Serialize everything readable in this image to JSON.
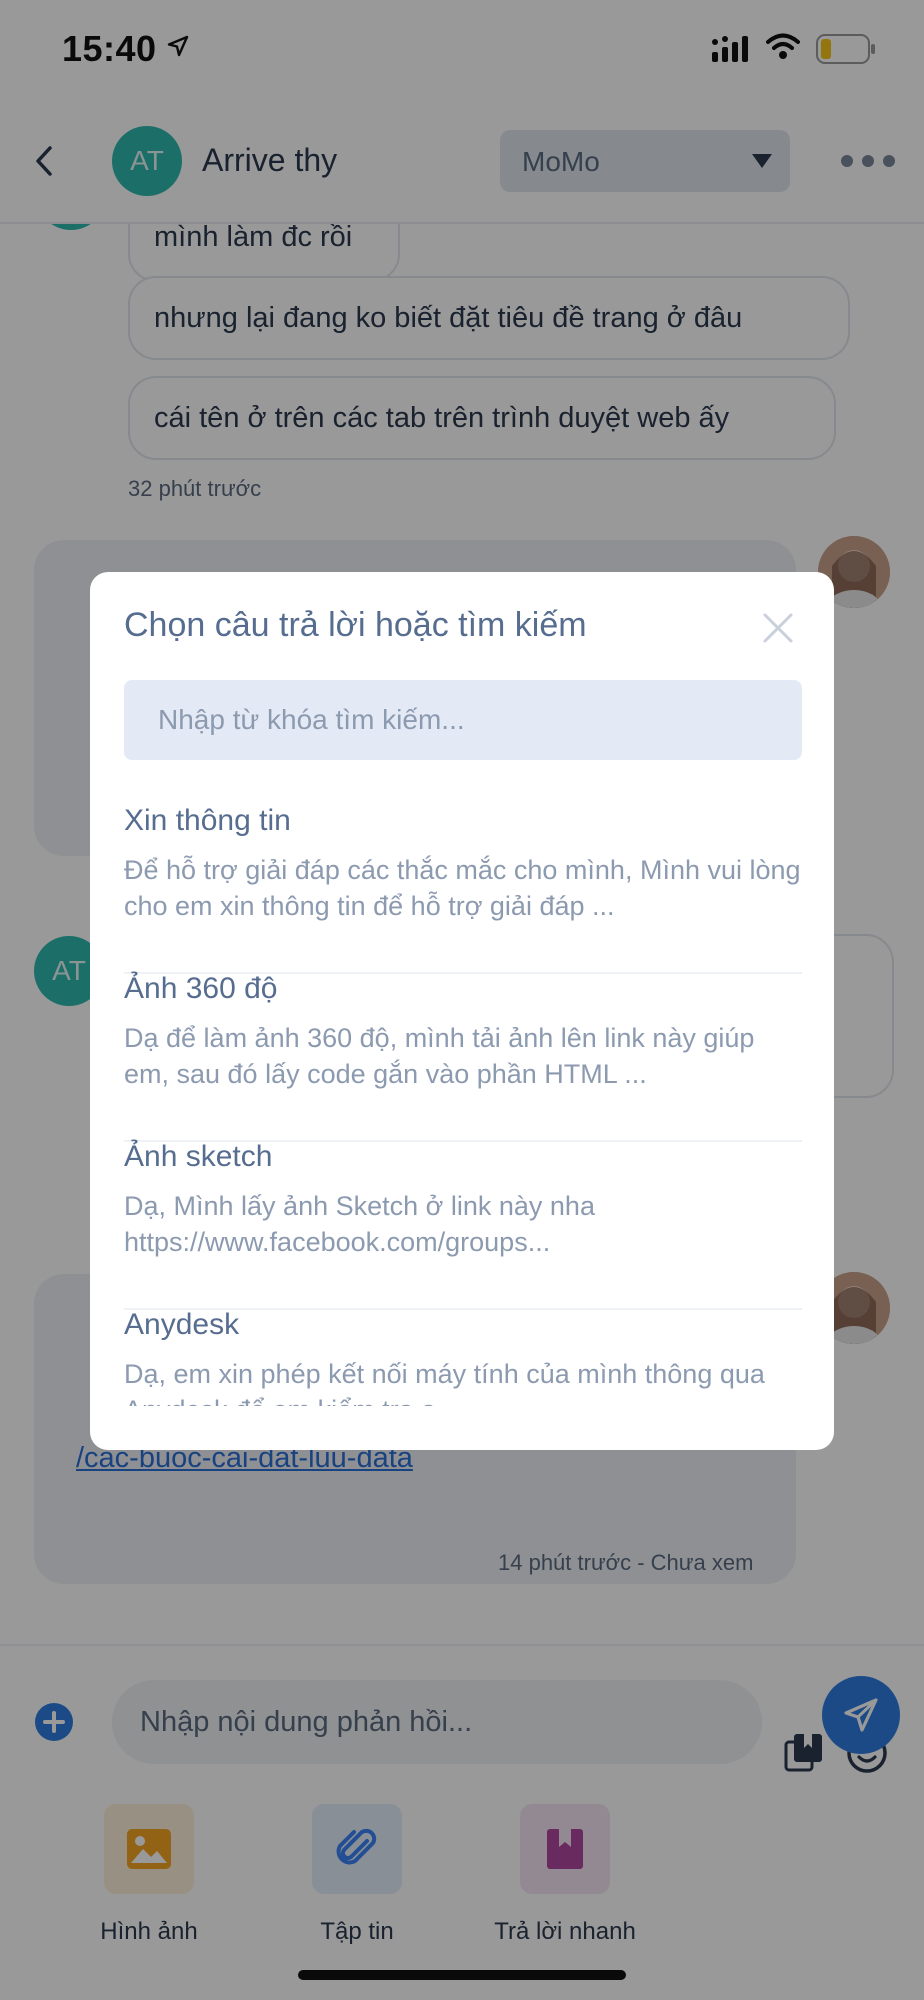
{
  "status_bar": {
    "time": "15:40",
    "icons": [
      "location-arrow-icon",
      "signal-icon",
      "wifi-icon",
      "battery-icon"
    ]
  },
  "header": {
    "avatar_initials": "AT",
    "contact_name": "Arrive thy",
    "channel_label": "MoMo",
    "icons": [
      "back-icon",
      "chevron-down-icon",
      "more-icon"
    ]
  },
  "chat": {
    "messages_in": [
      "mình làm đc rồi",
      "nhưng lại đang ko biết đặt tiêu đề trang ở đâu",
      "cái tên ở trên các tab trên trình duyệt web ấy"
    ],
    "time_1": "32 phút trước",
    "link_text": "/cac-buoc-cai-dat-luu-data",
    "time_2": "14 phút trước - Chưa xem",
    "mid_avatar_initials": "AT"
  },
  "composer": {
    "placeholder": "Nhập nội dung phản hồi...",
    "icons": [
      "plus-circle-icon",
      "template-icon",
      "emoji-icon",
      "send-icon"
    ]
  },
  "attachments": [
    {
      "label": "Hình ảnh",
      "icon": "image-icon"
    },
    {
      "label": "Tập tin",
      "icon": "paperclip-icon"
    },
    {
      "label": "Trả lời nhanh",
      "icon": "bookmark-icon"
    }
  ],
  "modal": {
    "title": "Chọn câu trả lời hoặc tìm kiếm",
    "search_placeholder": "Nhập từ khóa tìm kiếm...",
    "replies": [
      {
        "title": "Xin thông tin",
        "body": "Để hỗ trợ giải đáp các thắc mắc cho mình,  Mình vui lòng cho em xin thông tin để hỗ trợ giải đáp ..."
      },
      {
        "title": "Ảnh 360 độ",
        "body": "Dạ để làm ảnh 360 độ, mình tải ảnh lên link này giúp em, sau đó lấy code gắn vào phần HTML ..."
      },
      {
        "title": "Ảnh sketch",
        "body": "Dạ, Mình lấy ảnh Sketch ở link này nha https://www.facebook.com/groups..."
      },
      {
        "title": "Anydesk",
        "body": "Dạ, em xin phép kết nối máy tính của mình thông qua Anydesk để em kiểm tra ạ"
      }
    ]
  },
  "colors": {
    "teal_avatar": "#2fb8ae",
    "accent_blue": "#2d7ce0",
    "modal_title": "#566d90",
    "muted_text": "#8c9ab0"
  }
}
